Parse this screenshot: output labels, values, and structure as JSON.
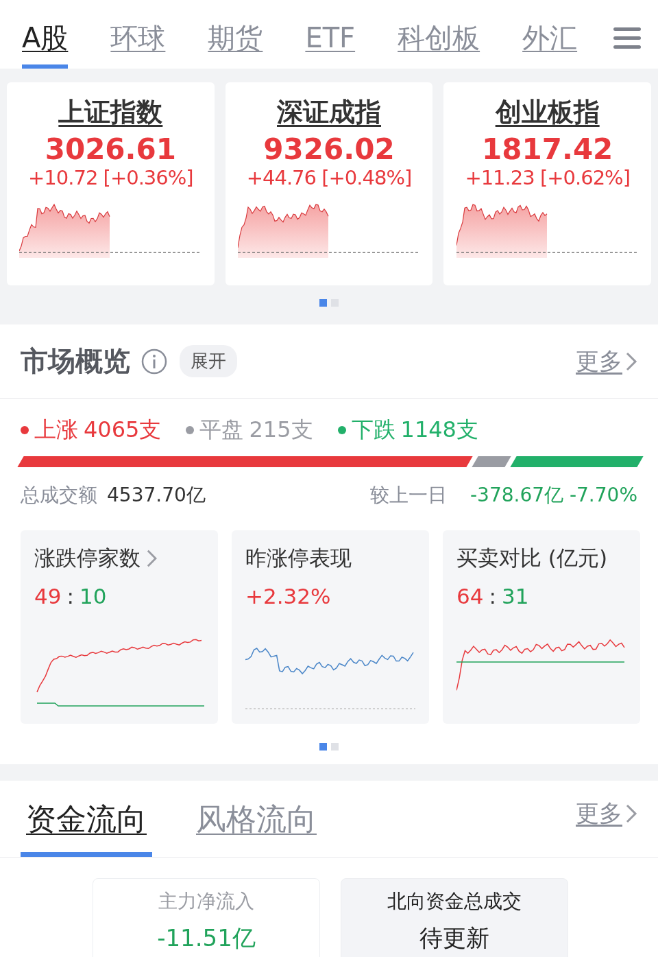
{
  "tabs": [
    {
      "label": "A股",
      "selected": true
    },
    {
      "label": "环球",
      "selected": false
    },
    {
      "label": "期货",
      "selected": false
    },
    {
      "label": "ETF",
      "selected": false
    },
    {
      "label": "科创板",
      "selected": false
    },
    {
      "label": "外汇",
      "selected": false
    }
  ],
  "indices": [
    {
      "name": "上证指数",
      "value": "3026.61",
      "change": "+10.72 [+0.36%]"
    },
    {
      "name": "深证成指",
      "value": "9326.02",
      "change": "+44.76 [+0.48%]"
    },
    {
      "name": "创业板指",
      "value": "1817.42",
      "change": "+11.23 [+0.62%]"
    }
  ],
  "index_pages": [
    {
      "selected": true
    },
    {
      "selected": false
    }
  ],
  "market_overview": {
    "title": "市场概览",
    "expand": "展开",
    "more": "更多",
    "breadth": [
      {
        "label": "上涨",
        "count": "4065支",
        "color": "#e8393d"
      },
      {
        "label": "平盘",
        "count": "215支",
        "color": "#9a9ca3"
      },
      {
        "label": "下跌",
        "count": "1148支",
        "color": "#22b06a"
      }
    ],
    "turnover_label": "总成交额",
    "turnover": "4537.70亿",
    "compare_label": "较上一日",
    "compare": "-378.67亿 -7.70%",
    "cards": [
      {
        "title": "涨跌停家数",
        "link": true,
        "parts": [
          {
            "text": "49",
            "color": "#e8393d"
          },
          {
            "text": ":",
            "color": "#333333"
          },
          {
            "text": "10",
            "color": "#21a35b"
          }
        ]
      },
      {
        "title": "昨涨停表现",
        "link": false,
        "parts": [
          {
            "text": "+2.32%",
            "color": "#e8393d"
          }
        ]
      },
      {
        "title": "买卖对比 (亿元)",
        "link": false,
        "parts": [
          {
            "text": "64",
            "color": "#e8393d"
          },
          {
            "text": ":",
            "color": "#333333"
          },
          {
            "text": "31",
            "color": "#21a35b"
          }
        ]
      }
    ],
    "pages": [
      {
        "selected": true
      },
      {
        "selected": false
      }
    ]
  },
  "fund_flow": {
    "tabs": [
      {
        "label": "资金流向",
        "selected": true
      },
      {
        "label": "风格流向",
        "selected": false
      }
    ],
    "more": "更多",
    "cards": [
      {
        "kind": "flow",
        "label": "主力净流入",
        "value": "-11.51亿"
      },
      {
        "kind": "pending",
        "label": "北向资金总成交",
        "value": "待更新"
      }
    ]
  }
}
